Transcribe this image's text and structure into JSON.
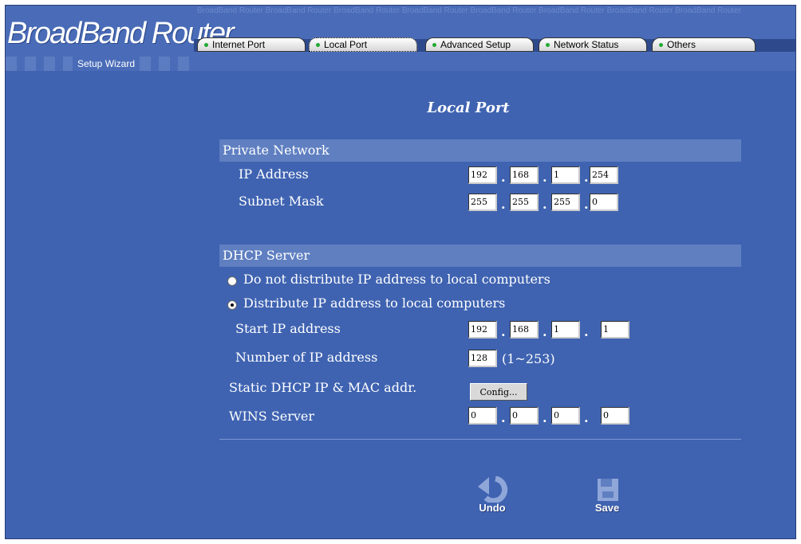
{
  "header": {
    "brand": "BroadBand Router",
    "wizard_label": "Setup Wizard",
    "watermark": "BroadBand Router  BroadBand Router  BroadBand Router  BroadBand Router  BroadBand Router  BroadBand Router  BroadBand Router  BroadBand Router"
  },
  "tabs": [
    {
      "label": "Internet Port"
    },
    {
      "label": "Local Port",
      "active": true
    },
    {
      "label": "Advanced Setup"
    },
    {
      "label": "Network Status"
    },
    {
      "label": "Others"
    }
  ],
  "page_title": "Local Port",
  "private_network": {
    "heading": "Private Network",
    "ip_label": "IP Address",
    "ip": [
      "192",
      "168",
      "1",
      "254"
    ],
    "mask_label": "Subnet Mask",
    "mask": [
      "255",
      "255",
      "255",
      "0"
    ]
  },
  "dhcp": {
    "heading": "DHCP Server",
    "opt_disable": "Do not distribute IP address to local computers",
    "opt_enable": "Distribute IP address to local computers",
    "selected": "enable",
    "start_label": "Start IP address",
    "start_ip": [
      "192",
      "168",
      "1",
      "1"
    ],
    "count_label": "Number of IP address",
    "count": "128",
    "count_range": "(1~253)",
    "static_label": "Static DHCP IP & MAC addr.",
    "config_button": "Config...",
    "wins_label": "WINS Server",
    "wins": [
      "0",
      "0",
      "0",
      "0"
    ]
  },
  "actions": {
    "undo": "Undo",
    "save": "Save"
  },
  "colors": {
    "background": "#3f63b1",
    "section_bar": "#5f7fc1",
    "tab_dot": "#22aa33"
  }
}
